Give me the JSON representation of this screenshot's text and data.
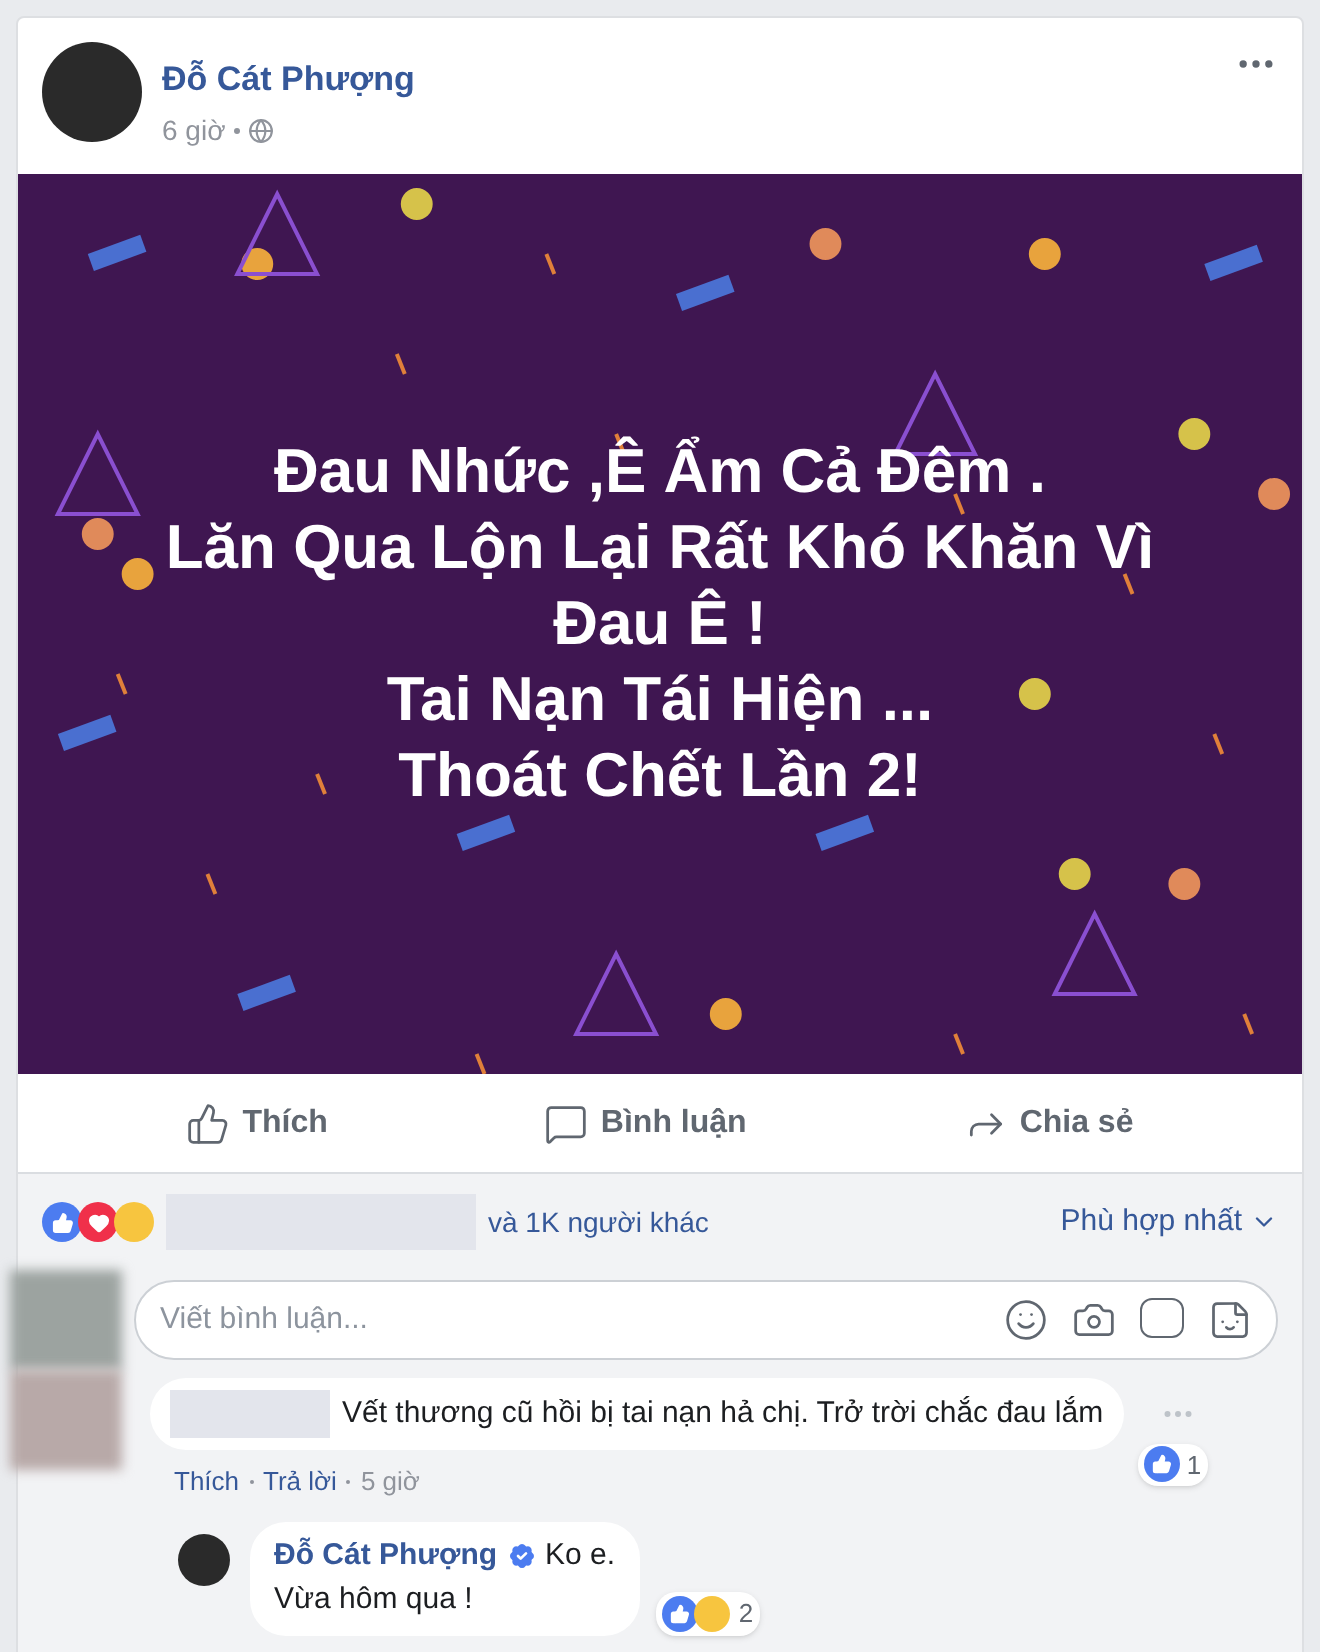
{
  "post": {
    "author": "Đỗ Cát Phượng",
    "time": "6 giờ",
    "poster_lines": [
      "Đau Nhức ,Ê Ẩm Cả Đêm .",
      "Lăn Qua Lộn Lại Rất Khó Khăn Vì",
      "Đau Ê !",
      "Tai Nạn Tái Hiện ...",
      "Thoát Chết Lần 2!"
    ]
  },
  "actions": [
    {
      "kind": "like",
      "label": "Thích"
    },
    {
      "kind": "comment",
      "label": "Bình luận"
    },
    {
      "kind": "share",
      "label": "Chia sẻ"
    }
  ],
  "reactions": {
    "others": "và 1K người khác",
    "sort": "Phù hợp nhất"
  },
  "comment_box": {
    "placeholder": "Viết bình luận..."
  },
  "comment": {
    "text": "Vết thương cũ hồi bị tai nạn hả chị. Trở trời chắc đau lắm",
    "like_count": "1",
    "actions": [
      "Thích",
      "Trả lời"
    ],
    "time": "5 giờ"
  },
  "reply": {
    "author": "Đỗ Cát Phượng",
    "verified": true,
    "lines": [
      "Ko e.",
      "Vừa hôm qua !"
    ],
    "reaction_count": "2"
  }
}
